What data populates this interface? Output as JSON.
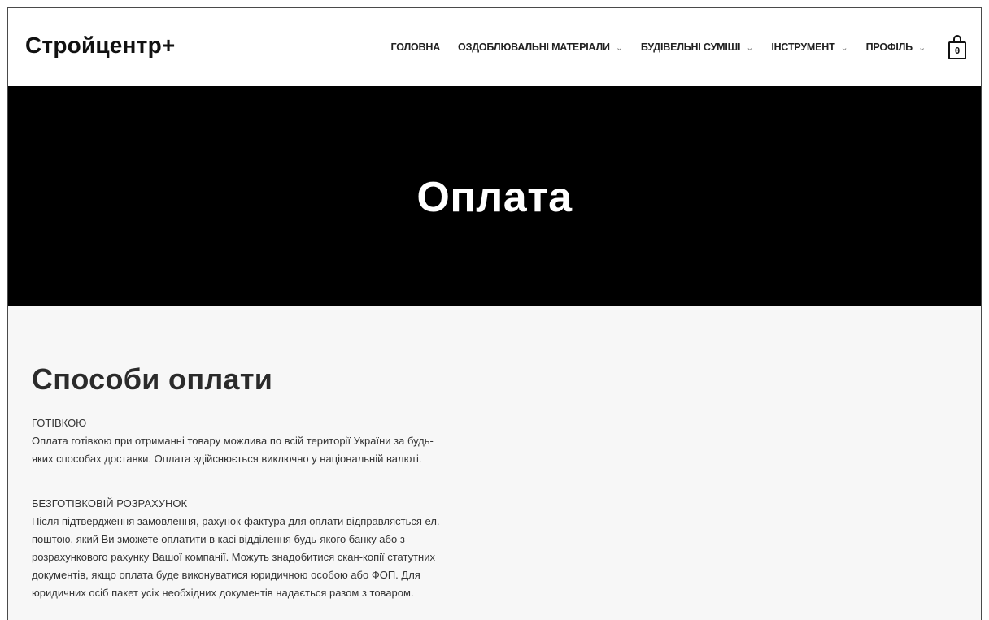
{
  "header": {
    "logo": "Стройцентр+",
    "nav": [
      {
        "label": "ГОЛОВНА",
        "has_dropdown": false
      },
      {
        "label": "ОЗДОБЛЮВАЛЬНІ МАТЕРІАЛИ",
        "has_dropdown": true
      },
      {
        "label": "БУДІВЕЛЬНІ СУМІШІ",
        "has_dropdown": true
      },
      {
        "label": "ІНСТРУМЕНТ",
        "has_dropdown": true
      },
      {
        "label": "ПРОФІЛЬ",
        "has_dropdown": true
      }
    ],
    "cart_count": "0"
  },
  "hero": {
    "title": "Оплата"
  },
  "main": {
    "section_title": "Способи оплати",
    "blocks": [
      {
        "heading": "ГОТІВКОЮ",
        "lines": [
          "Оплата готівкою при отриманні товару можлива по всій території України за будь-",
          "яких способах доставки. Оплата здійснюється виключно у національній валюті."
        ]
      },
      {
        "heading": "БЕЗГОТІВКОВІЙ РОЗРАХУНОК",
        "lines": [
          "Після підтвердження замовлення, рахунок-фактура для оплати відправляється ел.",
          "поштою, який Ви зможете оплатити в касі відділення будь-якого банку або з",
          "розрахункового рахунку Вашої компанії. Можуть знадобитися скан-копії статутних",
          "документів, якщо оплата буде виконуватися юридичною особою або ФОП. Для",
          "юридичних осіб пакет усіх необхідних документів надається разом з товаром."
        ]
      }
    ]
  },
  "colors": {
    "hero_bg": "#000000",
    "content_bg": "#f7f7f7",
    "text": "#333333"
  },
  "icons": {
    "dropdown": "chevron-down-icon",
    "cart": "shopping-bag-icon"
  }
}
